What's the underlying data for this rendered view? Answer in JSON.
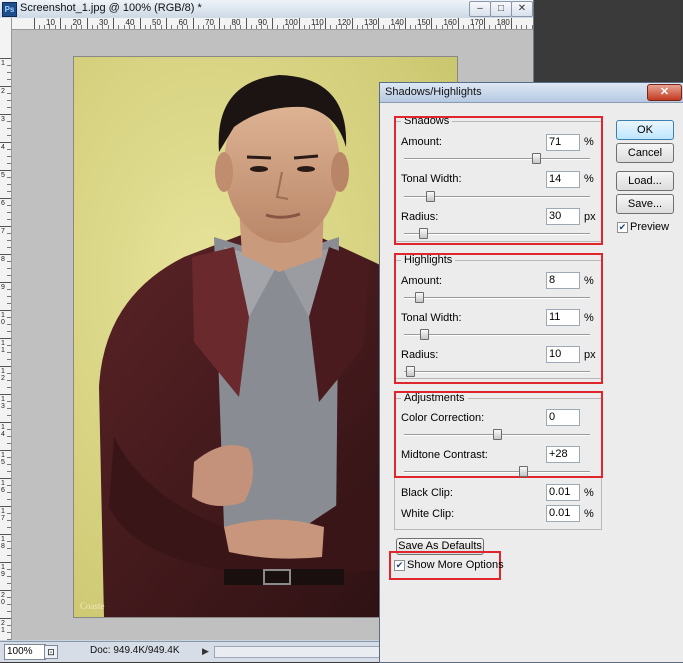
{
  "document": {
    "title": "Screenshot_1.jpg @ 100% (RGB/8) *",
    "app_icon": "Ps",
    "window_buttons": [
      "–",
      "□",
      "✕"
    ],
    "zoom": "100%",
    "doc_info": "Doc: 949.4K/949.4K",
    "ruler_h_labels": [
      "10",
      "20",
      "30",
      "40",
      "50",
      "60",
      "70",
      "80",
      "90",
      "100",
      "110",
      "120",
      "130",
      "140",
      "150",
      "160",
      "170",
      "180"
    ],
    "ruler_v_labels": [
      "1",
      "2",
      "3",
      "4",
      "5",
      "6",
      "7",
      "8",
      "9",
      "10",
      "11",
      "12",
      "13",
      "14",
      "15",
      "16",
      "17",
      "18",
      "19",
      "20",
      "21",
      "22"
    ],
    "watermark": "Coaste"
  },
  "dialog": {
    "title": "Shadows/Highlights",
    "close_glyph": "✕",
    "shadows": {
      "title": "Shadows",
      "amount_label": "Amount:",
      "amount": "71",
      "amount_unit": "%",
      "amount_level": 0.71,
      "tonal_label": "Tonal Width:",
      "tonal": "14",
      "tonal_unit": "%",
      "tonal_level": 0.14,
      "radius_label": "Radius:",
      "radius": "30",
      "radius_unit": "px",
      "radius_level": 0.1
    },
    "highlights": {
      "title": "Highlights",
      "amount_label": "Amount:",
      "amount": "8",
      "amount_unit": "%",
      "amount_level": 0.08,
      "tonal_label": "Tonal Width:",
      "tonal": "11",
      "tonal_unit": "%",
      "tonal_level": 0.11,
      "radius_label": "Radius:",
      "radius": "10",
      "radius_unit": "px",
      "radius_level": 0.03
    },
    "adjustments": {
      "title": "Adjustments",
      "color_label": "Color Correction:",
      "color": "0",
      "color_level": 0.5,
      "midtone_label": "Midtone Contrast:",
      "midtone": "+28",
      "midtone_level": 0.64,
      "black_label": "Black Clip:",
      "black": "0.01",
      "black_unit": "%",
      "white_label": "White Clip:",
      "white": "0.01",
      "white_unit": "%"
    },
    "buttons": {
      "ok": "OK",
      "cancel": "Cancel",
      "load": "Load...",
      "save": "Save...",
      "save_defaults": "Save As Defaults"
    },
    "preview": {
      "label": "Preview",
      "checked": true
    },
    "show_more": {
      "label": "Show More Options",
      "checked": true
    },
    "accent_red": "#e0262c"
  }
}
